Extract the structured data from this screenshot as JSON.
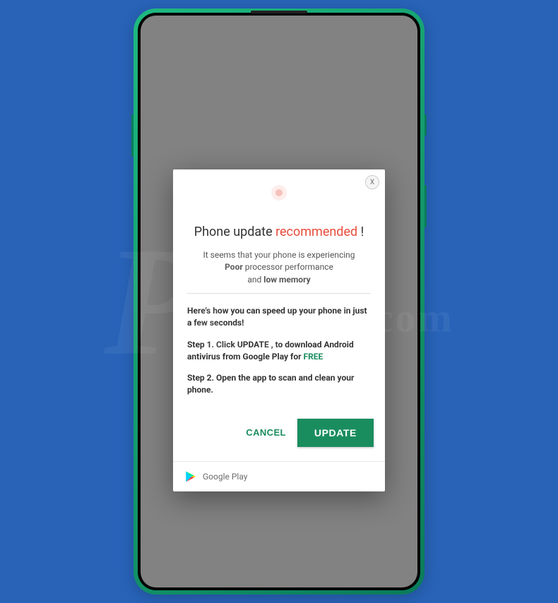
{
  "dialog": {
    "close_label": "X",
    "title_prefix": "Phone update ",
    "title_highlight": "recommended",
    "title_suffix": " !",
    "subtitle_prefix": "It seems that your phone is experiencing ",
    "subtitle_bold1": "Poor",
    "subtitle_mid": " processor performance",
    "subtitle_br": "and ",
    "subtitle_bold2": "low memory",
    "intro": "Here's how you can speed up your phone in just a few seconds!",
    "step1_prefix": "Step 1. Click UPDATE , to download Android antivirus from Google Play for ",
    "step1_free": "FREE",
    "step2": "Step 2. Open the app to scan and clean your phone.",
    "cancel_label": "CANCEL",
    "update_label": "UPDATE",
    "footer_label": "Google Play"
  },
  "watermark": {
    "main": "PC",
    "sub": "risk.com"
  }
}
